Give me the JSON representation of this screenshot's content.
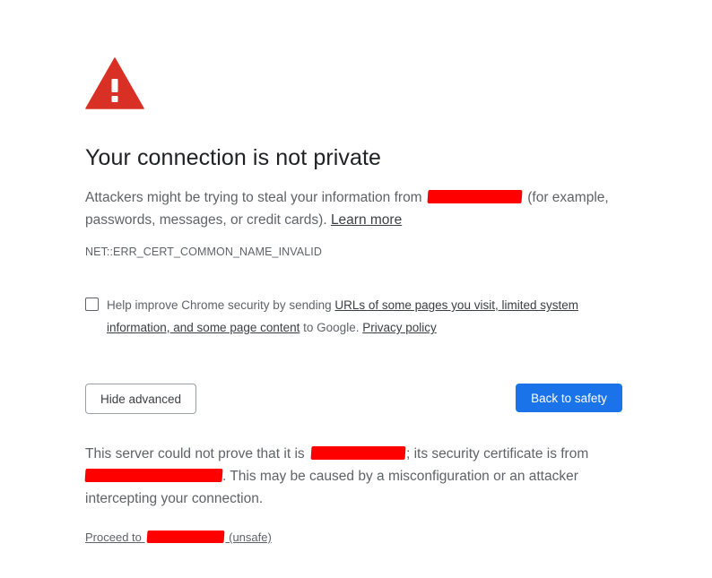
{
  "icon": "warning-triangle-icon",
  "colors": {
    "warning_red": "#d93025",
    "primary_blue": "#1a73e8",
    "redaction_red": "#ff0000"
  },
  "title": "Your connection is not private",
  "explanation": {
    "before_redaction": "Attackers might be trying to steal your information from",
    "after_redaction": "(for example, passwords, messages, or credit cards).",
    "learn_more": "Learn more"
  },
  "error_code": "NET::ERR_CERT_COMMON_NAME_INVALID",
  "checkbox": {
    "checked": false,
    "text_before": "Help improve Chrome security by sending",
    "link_text": "URLs of some pages you visit, limited system information, and some page content",
    "text_after": "to Google.",
    "privacy_link": "Privacy policy"
  },
  "buttons": {
    "hide_advanced": "Hide advanced",
    "back_to_safety": "Back to safety"
  },
  "details": {
    "part1": "This server could not prove that it is",
    "part2": "; its security certificate is from",
    "part3": ". This may be caused by a misconfiguration or an attacker intercepting your connection."
  },
  "proceed": {
    "prefix": "Proceed to",
    "suffix": "(unsafe)"
  }
}
